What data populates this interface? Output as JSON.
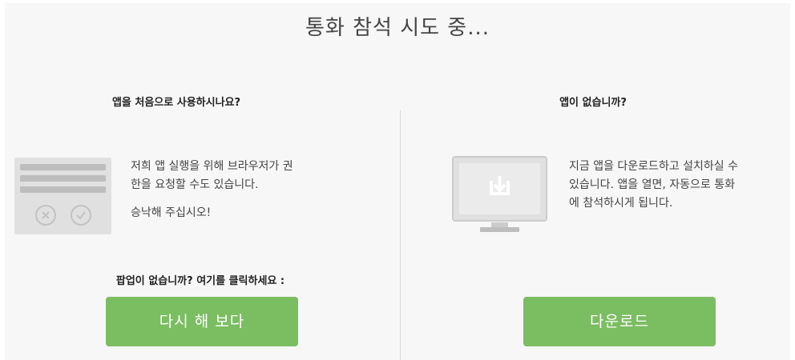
{
  "title": "통화 참석 시도 중...",
  "left": {
    "heading": "앱을 처음으로 사용하시나요?",
    "body_line1": "저희 앱 실행을 위해 브라우저가 권",
    "body_line2": "한을 요청할 수도 있습니다.",
    "body_line3": "승낙해 주십시오!",
    "popup_prompt": "팝업이 없습니까? 여기를 클릭하세요 :",
    "button_label": "다시 해 보다",
    "illustration_icons": [
      "deny-icon",
      "allow-icon"
    ]
  },
  "right": {
    "heading": "앱이 없습니까?",
    "body_line1": "지금 앱을 다운로드하고 설치하실 수",
    "body_line2": "있습니다. 앱을 열면, 자동으로 통화",
    "body_line3": "에 참석하시게 됩니다.",
    "button_label": "다운로드",
    "illustration_icon": "monitor-download-icon"
  },
  "colors": {
    "button": "#7bbd61",
    "background": "#f7f7f7",
    "illustration": "#e0e0e0"
  }
}
